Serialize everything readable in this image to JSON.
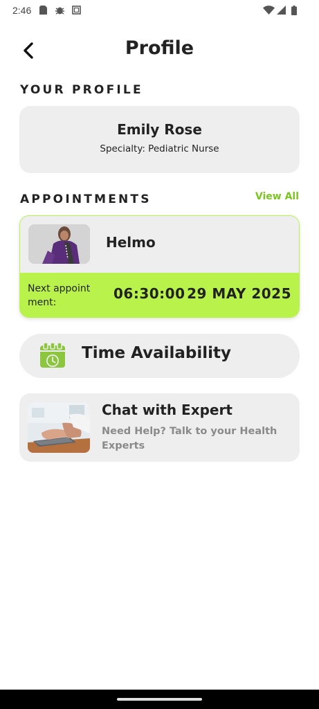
{
  "status_bar": {
    "time": "2:46",
    "left_icons": [
      "sim-card-icon",
      "bug-icon",
      "square-icon"
    ],
    "right_icons": [
      "wifi-icon",
      "signal-icon",
      "battery-icon"
    ]
  },
  "header": {
    "title": "Profile",
    "back_icon": "chevron-left-icon"
  },
  "profile": {
    "section_label": "YOUR PROFILE",
    "name": "Emily Rose",
    "specialty": "Specialty: Pediatric Nurse"
  },
  "appointments": {
    "section_label": "APPOINTMENTS",
    "view_all_label": "View All",
    "item": {
      "name": "Helmo",
      "next_label": "Next appoint ment:",
      "time": "06:30:00",
      "date": "29 MAY 2025"
    }
  },
  "time_availability": {
    "label": "Time Availability",
    "icon": "calendar-clock-icon"
  },
  "chat": {
    "title": "Chat with Expert",
    "subtitle": "Need Help? Talk to your Health Experts"
  },
  "colors": {
    "accent": "#b9f24a",
    "accent_text": "#7ac51f",
    "card_bg": "#eeeeee",
    "text": "#222222"
  }
}
